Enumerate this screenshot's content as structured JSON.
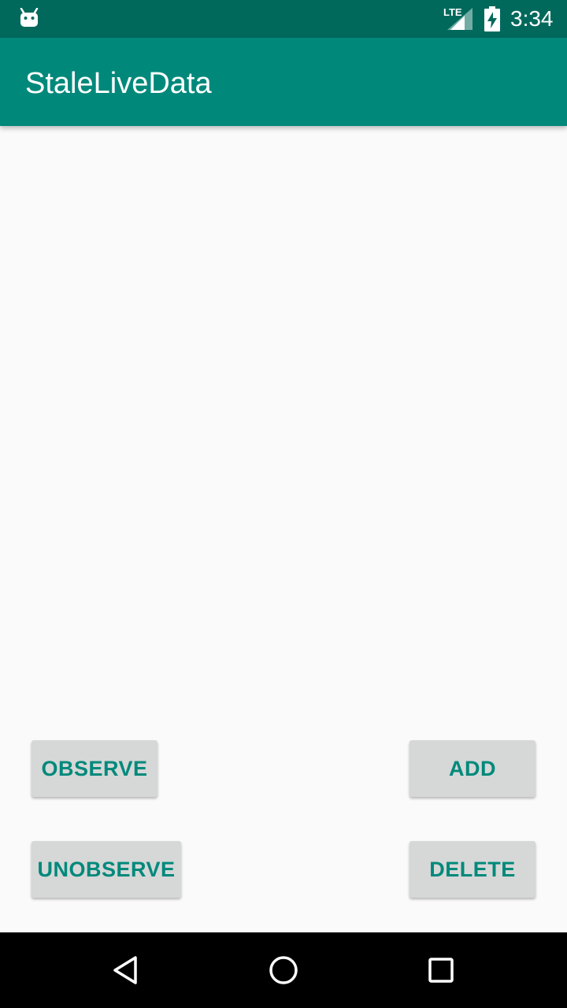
{
  "status_bar": {
    "network_label": "LTE",
    "time": "3:34",
    "icons": [
      "android-notification-icon",
      "signal-icon",
      "battery-charging-icon"
    ]
  },
  "app_bar": {
    "title": "StaleLiveData"
  },
  "buttons": {
    "observe": "OBSERVE",
    "add": "ADD",
    "unobserve": "UNOBSERVE",
    "delete": "DELETE"
  },
  "nav_bar": {
    "icons": [
      "back-icon",
      "home-icon",
      "recents-icon"
    ]
  },
  "colors": {
    "status_bar": "#00695c",
    "app_bar": "#00897b",
    "button_bg": "#d6d7d7",
    "button_text": "#00897b",
    "background": "#fafafa"
  }
}
